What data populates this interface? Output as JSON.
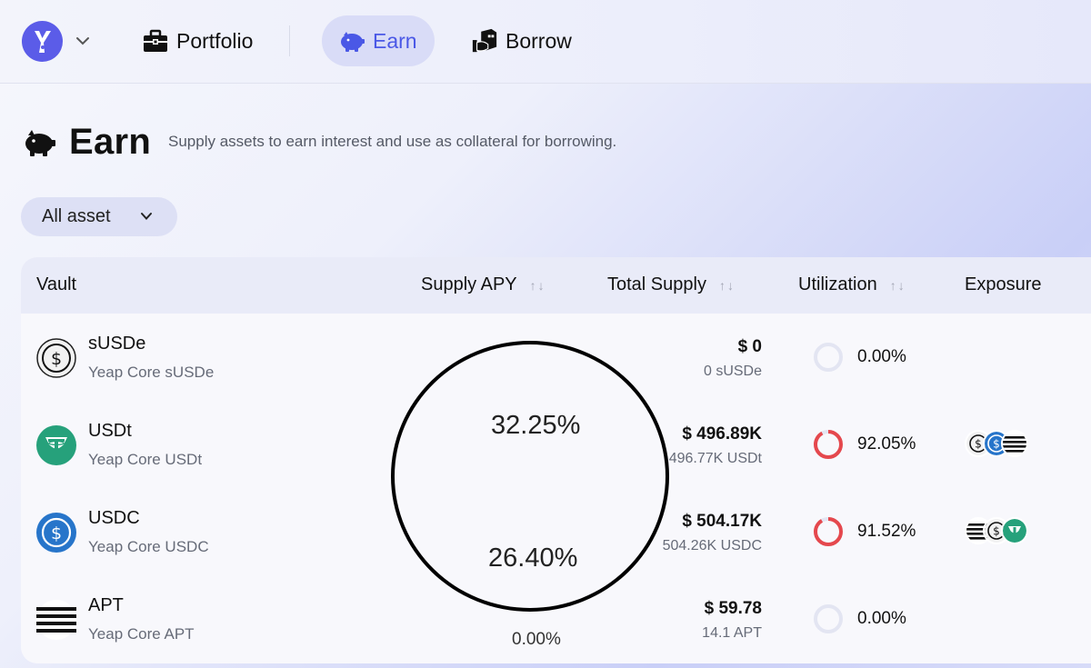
{
  "nav": {
    "items": [
      {
        "label": "Portfolio",
        "icon": "briefcase-icon"
      },
      {
        "label": "Earn",
        "icon": "piggy-bank-icon",
        "active": true
      },
      {
        "label": "Borrow",
        "icon": "borrow-icon"
      }
    ],
    "accent": "#4a58e6"
  },
  "page": {
    "title": "Earn",
    "subtitle": "Supply assets to earn interest and use as collateral for borrowing."
  },
  "filter": {
    "label": "All asset"
  },
  "table": {
    "columns": {
      "vault": "Vault",
      "apy": "Supply APY",
      "supply": "Total Supply",
      "util": "Utilization",
      "exposure": "Exposure"
    },
    "sort_glyph": "↑↓",
    "rows": [
      {
        "name": "sUSDe",
        "sub": "Yeap Core sUSDe",
        "apy": "",
        "supply": "$ 0",
        "supply_sub": "0 sUSDe",
        "util": "0.00%",
        "util_fraction": 0.0,
        "exposure": []
      },
      {
        "name": "USDt",
        "sub": "Yeap Core USDt",
        "apy": "32.25%",
        "supply": "$ 496.89K",
        "supply_sub": "496.77K USDt",
        "util": "92.05%",
        "util_fraction": 0.9205,
        "exposure": [
          "susde-icon",
          "usdc-icon",
          "apt-icon"
        ]
      },
      {
        "name": "USDC",
        "sub": "Yeap Core USDC",
        "apy": "26.40%",
        "supply": "$ 504.17K",
        "supply_sub": "504.26K USDC",
        "util": "91.52%",
        "util_fraction": 0.9152,
        "exposure": [
          "apt-icon",
          "susde-icon",
          "usdt-icon"
        ]
      },
      {
        "name": "APT",
        "sub": "Yeap Core APT",
        "apy": "0.00%",
        "supply": "$ 59.78",
        "supply_sub": "14.1 APT",
        "util": "0.00%",
        "util_fraction": 0.0,
        "exposure": []
      }
    ]
  },
  "annotation": {
    "apy_high": "32.25%",
    "apy_low": "26.40%"
  },
  "colors": {
    "usdt": "#26a17b",
    "usdc": "#2775ca",
    "util_high": "#e5484d",
    "util_empty": "#e3e5f2"
  }
}
